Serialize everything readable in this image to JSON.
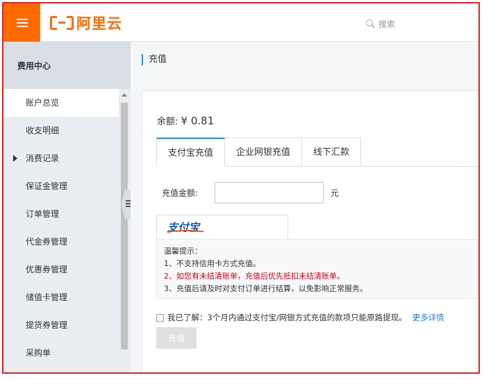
{
  "header": {
    "logo_text": "阿里云",
    "search_placeholder": "搜索",
    "brand_color": "#ff6a00"
  },
  "sidebar": {
    "title": "费用中心",
    "items": [
      {
        "label": "账户总览",
        "active": true
      },
      {
        "label": "收支明细"
      },
      {
        "label": "消费记录",
        "expandable": true
      },
      {
        "label": "保证金管理"
      },
      {
        "label": "订单管理"
      },
      {
        "label": "代金券管理"
      },
      {
        "label": "优惠券管理"
      },
      {
        "label": "储值卡管理"
      },
      {
        "label": "提货券管理"
      },
      {
        "label": "采购单"
      }
    ]
  },
  "main": {
    "breadcrumb": "充值",
    "balance_label": "余额:",
    "balance_value": "¥ 0.81",
    "tabs": [
      {
        "label": "支付宝充值",
        "active": true
      },
      {
        "label": "企业网银充值"
      },
      {
        "label": "线下汇款"
      }
    ],
    "amount_label": "充值金额:",
    "amount_value": "",
    "amount_unit": "元",
    "pay_method_logo": "支付宝",
    "notice": {
      "title": "温馨提示：",
      "line1": "1、不支持信用卡方式充值。",
      "line2": "2、如您有未结清账单，充值后优先抵扣未结清账单。",
      "line3": "3、充值后请及时对支付订单进行结算，以免影响正常服务。"
    },
    "agree_text": "我已了解：3个月内通过支付宝/网银方式充值的款项只能原路提现。",
    "agree_checked": false,
    "more_link": "更多详情",
    "submit_label": "充值"
  },
  "colors": {
    "accent_blue": "#2b8ecf",
    "warning_red": "#d0021b",
    "frame_red": "#e02020"
  }
}
